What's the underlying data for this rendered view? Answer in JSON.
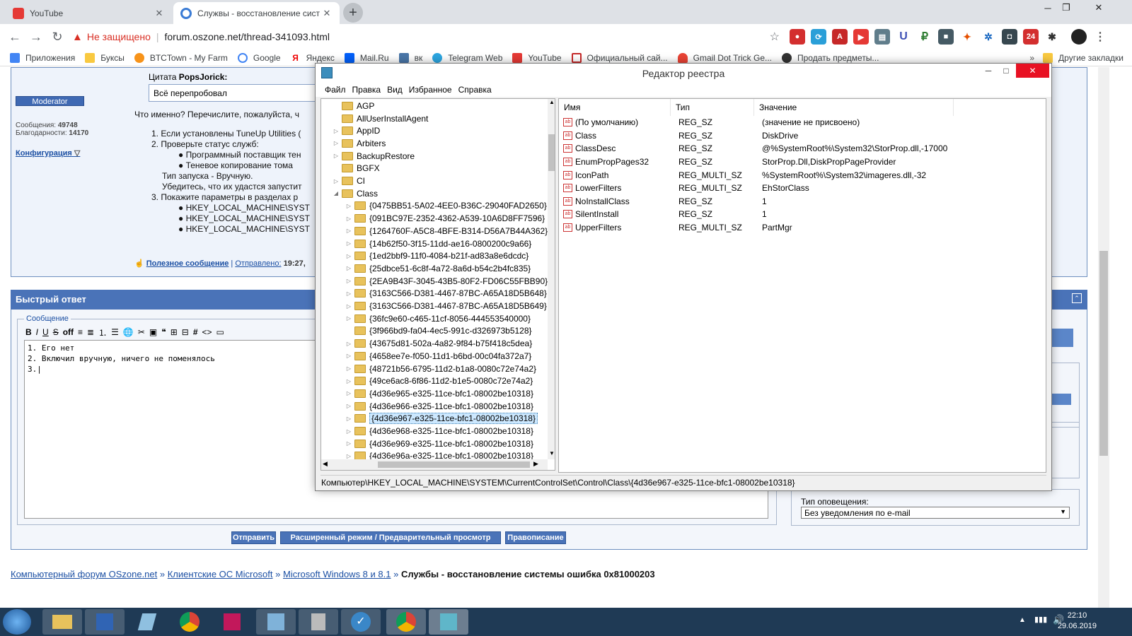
{
  "browser": {
    "tabs": [
      {
        "title": "YouTube",
        "active": false,
        "icon_color": "#e53935"
      },
      {
        "title": "Служвы - восстановление сист",
        "active": true,
        "icon_color": "#3a7bd5"
      }
    ],
    "url_warning": "Не защищено",
    "url": "forum.oszone.net/thread-341093.html",
    "bookmarks": [
      "Приложения",
      "Буксы",
      "BTCTown - My Farm",
      "Google",
      "Яндекс",
      "Mail.Ru",
      "вк",
      "Telegram Web",
      "YouTube",
      "Официальный сай...",
      "Gmail Dot Trick Ge...",
      "Продать предметы...",
      "Другие закладки"
    ]
  },
  "forum": {
    "quote_label": "Цитата",
    "quote_author": "PopsJorick:",
    "quote_text": "Всё перепробовал",
    "moderator_badge": "Moderator",
    "posts_label": "Сообщения:",
    "posts_count": "49748",
    "thanks_label": "Благодарности:",
    "thanks_count": "14170",
    "config_link": "Конфигурация",
    "reply_intro": "Что именно? Перечислите, пожалуйста, ч",
    "list_1": "1. Если установлены TuneUp Utilities (",
    "list_2": "2. Проверьте статус служб:",
    "list_2a": "Программный поставщик тен",
    "list_2b": "Теневое копирование тома",
    "list_type": "Тип запуска - Вручную.",
    "list_check": "Убедитесь, что их удастся запустит",
    "list_3": "3. Покажите параметры в разделах р",
    "list_3a": "HKEY_LOCAL_MACHINE\\SYST",
    "list_3b": "HKEY_LOCAL_MACHINE\\SYST",
    "list_3c": "HKEY_LOCAL_MACHINE\\SYST",
    "useful": "Полезное сообщение",
    "sent": "Отправлено:",
    "sent_time": "19:27,",
    "quick_reply": "Быстрый ответ",
    "message_legend": "Сообщение",
    "editor_line1": "1. Его нет",
    "editor_line2": "2. Включил вручную, ничего не поменялось",
    "editor_line3": "3.",
    "notify_label": "Тип оповещения:",
    "notify_value": "Без уведомления по e-mail",
    "btn_send": "Отправить",
    "btn_advanced": "Расширенный режим / Предварительный просмотр",
    "btn_spell": "Правописание",
    "crumb_1": "Компьютерный форум OSzone.net",
    "crumb_2": "Клиентские ОС Microsoft",
    "crumb_3": "Microsoft Windows 8 и 8.1",
    "crumb_current": "Службы - восстановление системы ошибка 0x81000203"
  },
  "regedit": {
    "title": "Редактор реестра",
    "menu": [
      "Файл",
      "Правка",
      "Вид",
      "Избранное",
      "Справка"
    ],
    "tree": [
      {
        "label": "AGP",
        "level": 1,
        "arrow": ""
      },
      {
        "label": "AllUserInstallAgent",
        "level": 1,
        "arrow": ""
      },
      {
        "label": "AppID",
        "level": 1,
        "arrow": "▷"
      },
      {
        "label": "Arbiters",
        "level": 1,
        "arrow": "▷"
      },
      {
        "label": "BackupRestore",
        "level": 1,
        "arrow": "▷"
      },
      {
        "label": "BGFX",
        "level": 1,
        "arrow": ""
      },
      {
        "label": "CI",
        "level": 1,
        "arrow": "▷"
      },
      {
        "label": "Class",
        "level": 1,
        "arrow": "◢"
      },
      {
        "label": "{0475BB51-5A02-4EE0-B36C-29040FAD2650}",
        "level": 2,
        "arrow": "▷"
      },
      {
        "label": "{091BC97E-2352-4362-A539-10A6D8FF7596}",
        "level": 2,
        "arrow": "▷"
      },
      {
        "label": "{1264760F-A5C8-4BFE-B314-D56A7B44A362}",
        "level": 2,
        "arrow": "▷"
      },
      {
        "label": "{14b62f50-3f15-11dd-ae16-0800200c9a66}",
        "level": 2,
        "arrow": "▷"
      },
      {
        "label": "{1ed2bbf9-11f0-4084-b21f-ad83a8e6dcdc}",
        "level": 2,
        "arrow": "▷"
      },
      {
        "label": "{25dbce51-6c8f-4a72-8a6d-b54c2b4fc835}",
        "level": 2,
        "arrow": "▷"
      },
      {
        "label": "{2EA9B43F-3045-43B5-80F2-FD06C55FBB90}",
        "level": 2,
        "arrow": "▷"
      },
      {
        "label": "{3163C566-D381-4467-87BC-A65A18D5B648}",
        "level": 2,
        "arrow": "▷"
      },
      {
        "label": "{3163C566-D381-4467-87BC-A65A18D5B649}",
        "level": 2,
        "arrow": "▷"
      },
      {
        "label": "{36fc9e60-c465-11cf-8056-444553540000}",
        "level": 2,
        "arrow": "▷"
      },
      {
        "label": "{3f966bd9-fa04-4ec5-991c-d326973b5128}",
        "level": 2,
        "arrow": ""
      },
      {
        "label": "{43675d81-502a-4a82-9f84-b75f418c5dea}",
        "level": 2,
        "arrow": "▷"
      },
      {
        "label": "{4658ee7e-f050-11d1-b6bd-00c04fa372a7}",
        "level": 2,
        "arrow": "▷"
      },
      {
        "label": "{48721b56-6795-11d2-b1a8-0080c72e74a2}",
        "level": 2,
        "arrow": "▷"
      },
      {
        "label": "{49ce6ac8-6f86-11d2-b1e5-0080c72e74a2}",
        "level": 2,
        "arrow": "▷"
      },
      {
        "label": "{4d36e965-e325-11ce-bfc1-08002be10318}",
        "level": 2,
        "arrow": "▷"
      },
      {
        "label": "{4d36e966-e325-11ce-bfc1-08002be10318}",
        "level": 2,
        "arrow": "▷"
      },
      {
        "label": "{4d36e967-e325-11ce-bfc1-08002be10318}",
        "level": 2,
        "arrow": "▷",
        "selected": true
      },
      {
        "label": "{4d36e968-e325-11ce-bfc1-08002be10318}",
        "level": 2,
        "arrow": "▷"
      },
      {
        "label": "{4d36e969-e325-11ce-bfc1-08002be10318}",
        "level": 2,
        "arrow": "▷"
      },
      {
        "label": "{4d36e96a-e325-11ce-bfc1-08002be10318}",
        "level": 2,
        "arrow": "▷"
      }
    ],
    "columns": [
      "Имя",
      "Тип",
      "Значение"
    ],
    "values": [
      {
        "name": "(По умолчанию)",
        "type": "REG_SZ",
        "data": "(значение не присвоено)"
      },
      {
        "name": "Class",
        "type": "REG_SZ",
        "data": "DiskDrive"
      },
      {
        "name": "ClassDesc",
        "type": "REG_SZ",
        "data": "@%SystemRoot%\\System32\\StorProp.dll,-17000"
      },
      {
        "name": "EnumPropPages32",
        "type": "REG_SZ",
        "data": "StorProp.Dll,DiskPropPageProvider"
      },
      {
        "name": "IconPath",
        "type": "REG_MULTI_SZ",
        "data": "%SystemRoot%\\System32\\imageres.dll,-32"
      },
      {
        "name": "LowerFilters",
        "type": "REG_MULTI_SZ",
        "data": "EhStorClass"
      },
      {
        "name": "NoInstallClass",
        "type": "REG_SZ",
        "data": "1"
      },
      {
        "name": "SilentInstall",
        "type": "REG_SZ",
        "data": "1"
      },
      {
        "name": "UpperFilters",
        "type": "REG_MULTI_SZ",
        "data": "PartMgr"
      }
    ],
    "status_path": "Компьютер\\HKEY_LOCAL_MACHINE\\SYSTEM\\CurrentControlSet\\Control\\Class\\{4d36e967-e325-11ce-bfc1-08002be10318}"
  },
  "taskbar": {
    "time": "22:10",
    "date": "29.06.2019"
  }
}
